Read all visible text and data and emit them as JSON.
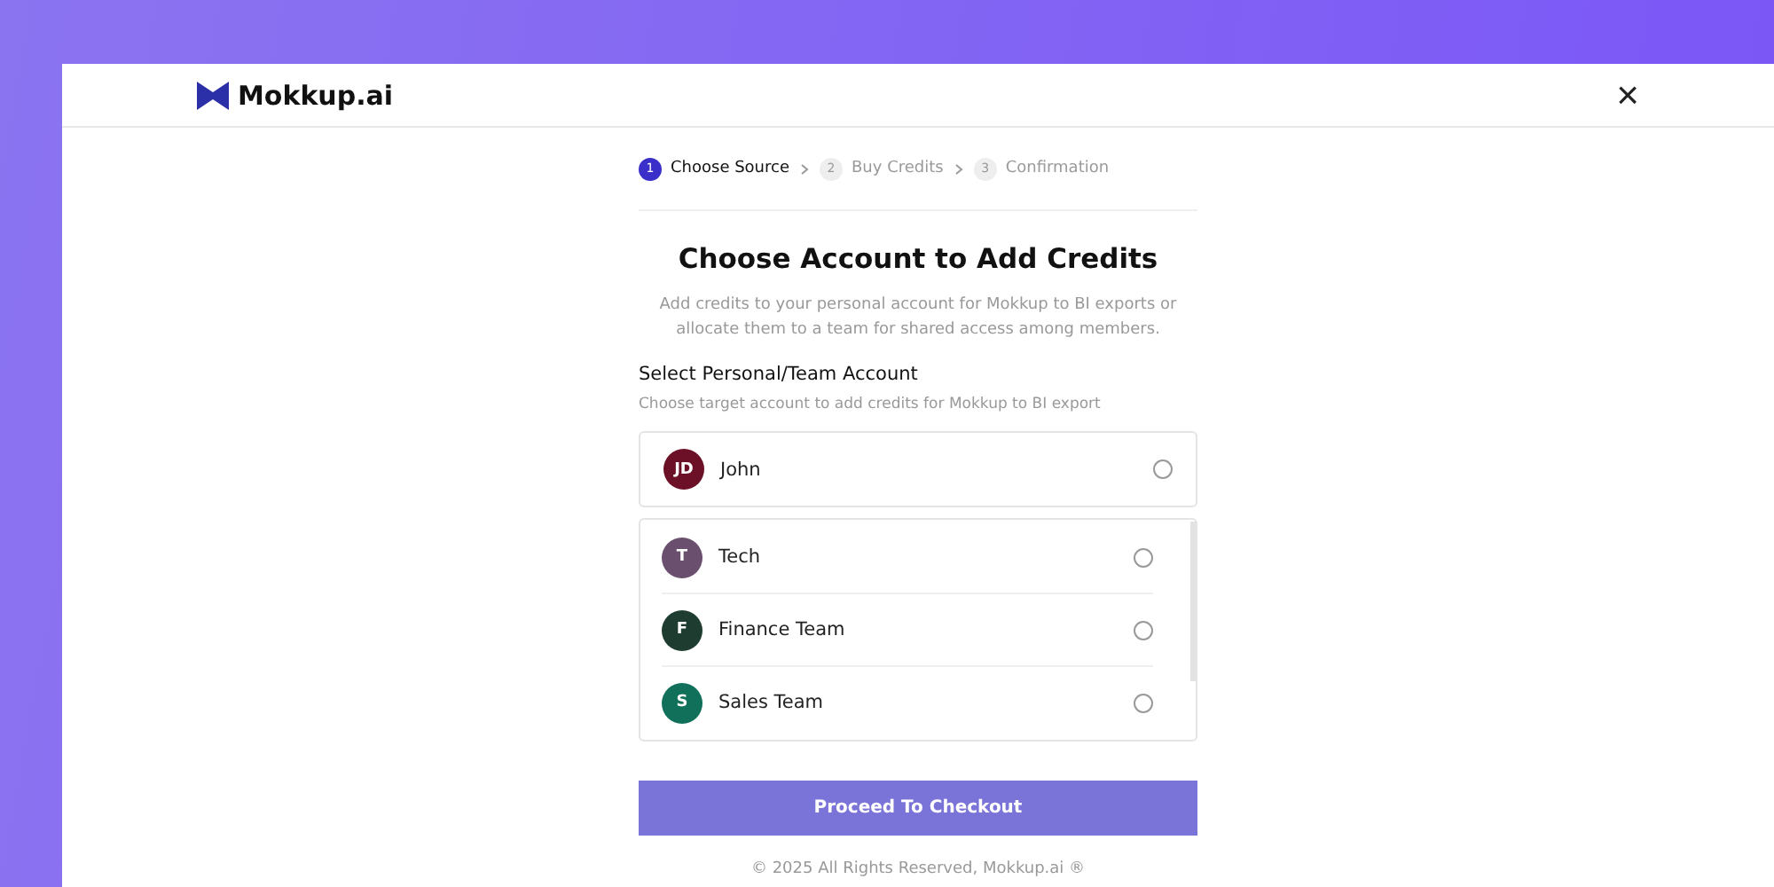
{
  "header": {
    "logo_text": "Mokkup.ai",
    "close": "×"
  },
  "steps": [
    {
      "number": "1",
      "label": "Choose Source",
      "selected": true
    },
    {
      "number": "2",
      "label": "Buy Credits",
      "selected": false
    },
    {
      "number": "3",
      "label": "Confirmation",
      "selected": false
    }
  ],
  "title": "Choose Account to Add Credits",
  "description": "Add credits to your personal account for Mokkup to BI exports or allocate them to a team for shared access among members.",
  "section": {
    "label": "Select Personal/Team Account",
    "hint": "Choose target account to add credits for Mokkup to BI export"
  },
  "personal_account": {
    "initials": "JD",
    "name": "John",
    "color": "#6b1026",
    "selected": false
  },
  "team_accounts": [
    {
      "initials": "T",
      "name": "Tech",
      "color": "#6b4f6e",
      "selected": false
    },
    {
      "initials": "F",
      "name": "Finance Team",
      "color": "#1e3d30",
      "selected": false
    },
    {
      "initials": "S",
      "name": "Sales Team",
      "color": "#11705a",
      "selected": false
    }
  ],
  "button": "Proceed To Checkout",
  "footer": "© 2025 All Rights Reserved, Mokkup.ai ®"
}
